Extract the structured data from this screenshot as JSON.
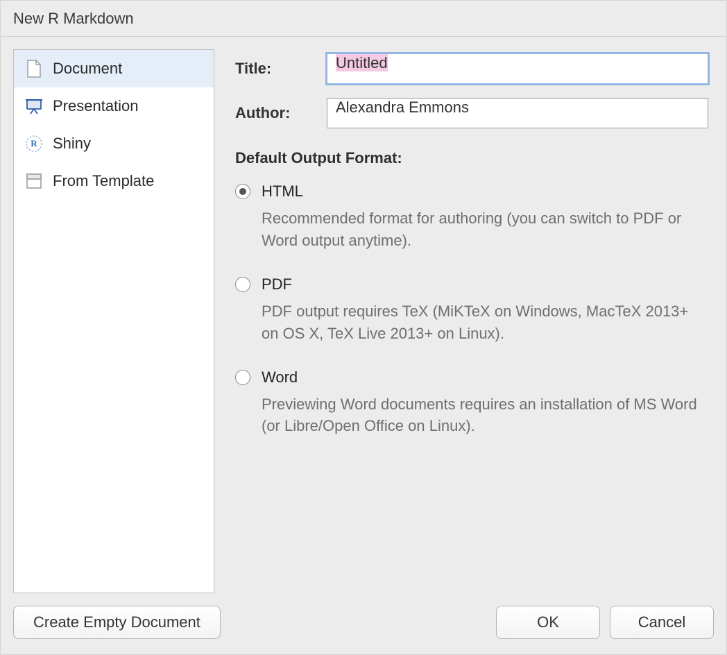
{
  "window": {
    "title": "New R Markdown"
  },
  "sidebar": {
    "items": [
      {
        "label": "Document",
        "icon": "document-icon",
        "selected": true
      },
      {
        "label": "Presentation",
        "icon": "presentation-icon",
        "selected": false
      },
      {
        "label": "Shiny",
        "icon": "shiny-icon",
        "selected": false
      },
      {
        "label": "From Template",
        "icon": "template-icon",
        "selected": false
      }
    ]
  },
  "form": {
    "title_label": "Title:",
    "title_value": "Untitled",
    "author_label": "Author:",
    "author_value": "Alexandra Emmons",
    "output_heading": "Default Output Format:",
    "options": [
      {
        "key": "html",
        "label": "HTML",
        "checked": true,
        "description": "Recommended format for authoring (you can switch to PDF or Word output anytime)."
      },
      {
        "key": "pdf",
        "label": "PDF",
        "checked": false,
        "description": "PDF output requires TeX (MiKTeX on Windows, MacTeX 2013+ on OS X, TeX Live 2013+ on Linux)."
      },
      {
        "key": "word",
        "label": "Word",
        "checked": false,
        "description": "Previewing Word documents requires an installation of MS Word (or Libre/Open Office on Linux)."
      }
    ]
  },
  "footer": {
    "create_empty": "Create Empty Document",
    "ok": "OK",
    "cancel": "Cancel"
  }
}
